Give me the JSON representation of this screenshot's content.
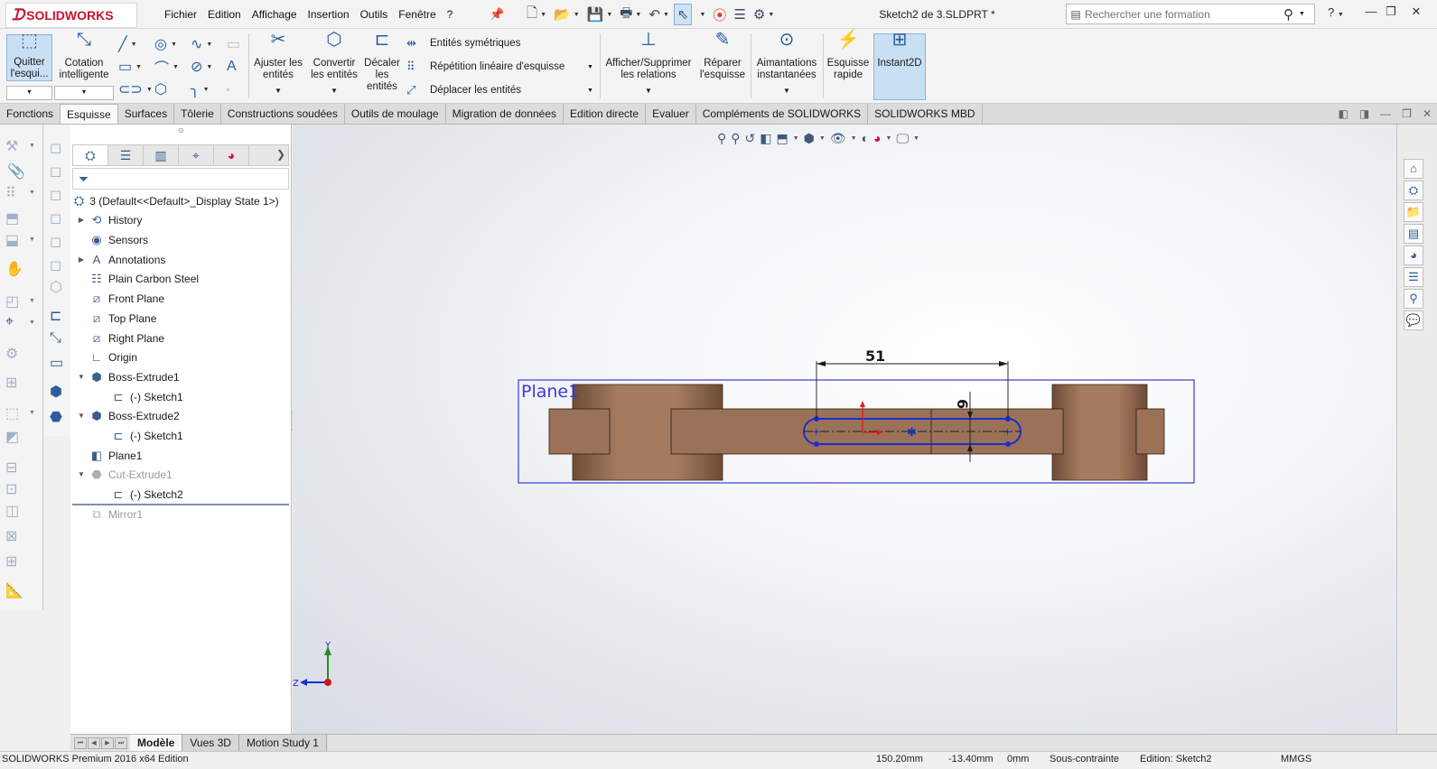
{
  "app": {
    "logo_text": "SOLIDWORKS",
    "document_title": "Sketch2 de 3.SLDPRT *",
    "brand_color": "#c8102e"
  },
  "menu": {
    "items": [
      "Fichier",
      "Edition",
      "Affichage",
      "Insertion",
      "Outils",
      "Fenêtre",
      "?"
    ]
  },
  "search": {
    "placeholder": "Rechercher une formation"
  },
  "help_label": "?",
  "ribbon": {
    "quit_sketch": "Quitter l'esqui...",
    "smart_dimension": "Cotation intelligente",
    "trim_entities": "Ajuster les entités",
    "convert_entities": "Convertir les entités",
    "offset_entities": "Décaler les entités",
    "mirror_entities": "Entités symétriques",
    "linear_pattern": "Répétition linéaire d'esquisse",
    "move_entities": "Déplacer les entités",
    "display_relations": "Afficher/Supprimer les relations",
    "repair_sketch": "Réparer l'esquisse",
    "quick_snaps": "Aimantations instantanées",
    "rapid_sketch": "Esquisse rapide",
    "instant2d": "Instant2D"
  },
  "cm_tabs": [
    "Fonctions",
    "Esquisse",
    "Surfaces",
    "Tôlerie",
    "Constructions soudées",
    "Outils de moulage",
    "Migration de données",
    "Edition directe",
    "Evaluer",
    "Compléments de SOLIDWORKS",
    "SOLIDWORKS MBD"
  ],
  "cm_active_tab": "Esquisse",
  "feature_tree": {
    "root": "3  (Default<<Default>_Display State 1>)",
    "items": [
      {
        "label": "History",
        "icon": "history-icon"
      },
      {
        "label": "Sensors",
        "icon": "sensor-icon"
      },
      {
        "label": "Annotations",
        "icon": "annotations-icon"
      },
      {
        "label": "Plain Carbon Steel",
        "icon": "material-icon"
      },
      {
        "label": "Front Plane",
        "icon": "plane-icon"
      },
      {
        "label": "Top Plane",
        "icon": "plane-icon"
      },
      {
        "label": "Right Plane",
        "icon": "plane-icon"
      },
      {
        "label": "Origin",
        "icon": "origin-icon"
      },
      {
        "label": "Boss-Extrude1",
        "icon": "extrude-icon"
      },
      {
        "label": "(-) Sketch1",
        "icon": "sketch-icon"
      },
      {
        "label": "Boss-Extrude2",
        "icon": "extrude-icon"
      },
      {
        "label": "(-) Sketch1",
        "icon": "sketch-icon"
      },
      {
        "label": "Plane1",
        "icon": "plane-icon"
      },
      {
        "label": "Cut-Extrude1",
        "icon": "cut-extrude-icon"
      },
      {
        "label": "(-) Sketch2",
        "icon": "sketch-icon"
      },
      {
        "label": "Mirror1",
        "icon": "mirror-icon"
      }
    ]
  },
  "graphics": {
    "plane_label": "Plane1",
    "dimension_horizontal": "51",
    "dimension_vertical": "6",
    "triad_y": "Y",
    "triad_z": "Z",
    "part_color": "#9b7258",
    "sketch_color": "#1a2ecf",
    "plane_color": "#3b3bd6"
  },
  "bottom_tabs": [
    "Modèle",
    "Vues 3D",
    "Motion Study 1"
  ],
  "bottom_active_tab": "Modèle",
  "status": {
    "product": "SOLIDWORKS Premium 2016 x64 Edition",
    "x_coord": "150.20mm",
    "y_coord": "-13.40mm",
    "z_coord": "0mm",
    "constraint": "Sous-contrainte",
    "editing": "Edition: Sketch2",
    "units": "MMGS"
  }
}
